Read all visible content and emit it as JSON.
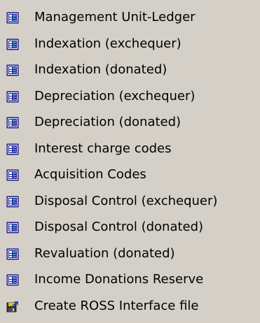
{
  "colors": {
    "menu_background": "#d4d0c8",
    "text": "#000000",
    "form_icon_frame": "#1a1a8c",
    "form_icon_fill": "#ffffff",
    "form_icon_accent": "#4a86c8",
    "run_icon_body": "#2a2a2a",
    "run_icon_label": "#e8c400",
    "run_icon_arrow": "#1e50c8"
  },
  "menu": {
    "items": [
      {
        "label": "Management Unit-Ledger",
        "icon": "form-icon"
      },
      {
        "label": "Indexation (exchequer)",
        "icon": "form-icon"
      },
      {
        "label": "Indexation (donated)",
        "icon": "form-icon"
      },
      {
        "label": "Depreciation (exchequer)",
        "icon": "form-icon"
      },
      {
        "label": "Depreciation (donated)",
        "icon": "form-icon"
      },
      {
        "label": "Interest charge codes",
        "icon": "form-icon"
      },
      {
        "label": "Acquisition Codes",
        "icon": "form-icon"
      },
      {
        "label": "Disposal Control (exchequer)",
        "icon": "form-icon"
      },
      {
        "label": "Disposal Control (donated)",
        "icon": "form-icon"
      },
      {
        "label": "Revaluation (donated)",
        "icon": "form-icon"
      },
      {
        "label": "Income Donations Reserve",
        "icon": "form-icon"
      },
      {
        "label": "Create ROSS Interface file",
        "icon": "export-file-icon"
      }
    ]
  }
}
